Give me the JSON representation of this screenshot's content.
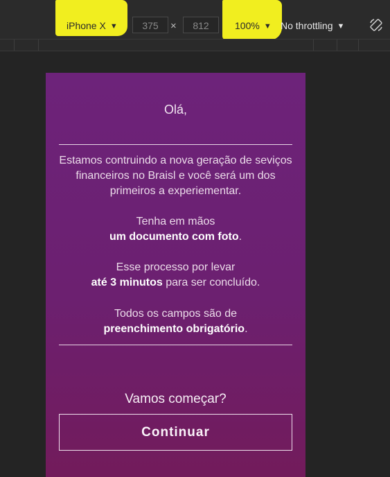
{
  "toolbar": {
    "device": "iPhone X",
    "width_value": "375",
    "height_value": "812",
    "times_symbol": "×",
    "zoom": "100%",
    "throttling": "No throttling",
    "caret": "▼",
    "highlight_color": "#f1ee1f",
    "rotate_icon": "rotate-icon"
  },
  "page": {
    "greeting": "Olá,",
    "intro": "Estamos contruindo a nova geração de seviços financeiros no Braisl e você será um dos primeiros a experiementar.",
    "doc_line1": "Tenha em mãos",
    "doc_bold": "um documento com foto",
    "doc_suffix": ".",
    "time_line1": "Esse processo por levar",
    "time_bold": "até 3 minutos",
    "time_suffix": " para ser concluído.",
    "fields_line1": "Todos os campos são de",
    "fields_bold": "preenchimento obrigatório",
    "fields_suffix": ".",
    "start_text": "Vamos começar?",
    "continue_label": "Continuar",
    "gradient_top": "#6d237a",
    "gradient_bottom": "#721b5b"
  }
}
